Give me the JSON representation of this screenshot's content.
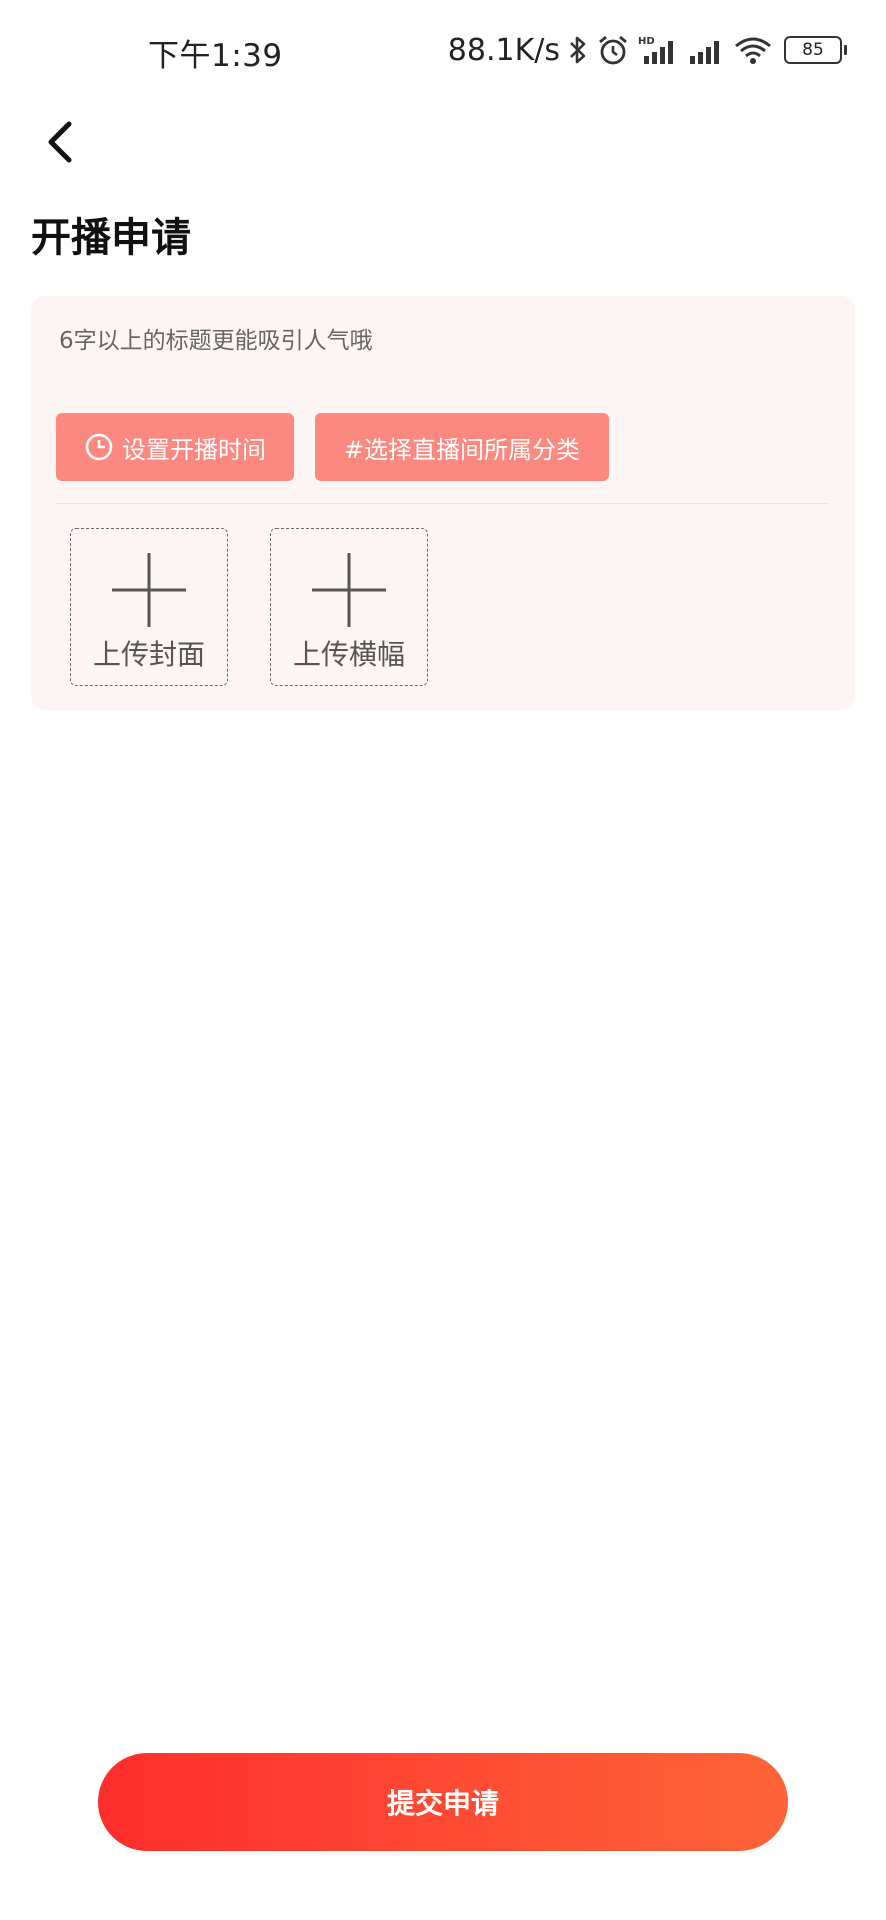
{
  "status_bar": {
    "time": "下午1:39",
    "net_speed": "88.1K/s",
    "battery": "85",
    "icons": [
      "bluetooth-icon",
      "alarm-icon",
      "hd-signal-icon",
      "signal-icon",
      "wifi-icon",
      "battery-icon"
    ]
  },
  "header": {
    "back_icon": "chevron-left-icon",
    "title": "开播申请"
  },
  "form": {
    "title_placeholder": "6字以上的标题更能吸引人气哦",
    "time_chip_label": "设置开播时间",
    "time_chip_icon": "clock-icon",
    "category_chip_label": "#选择直播间所属分类",
    "upload_cover_label": "上传封面",
    "upload_banner_label": "上传横幅"
  },
  "submit": {
    "label": "提交申请"
  },
  "colors": {
    "chip_bg": "#fc8880",
    "card_bg": "#fdf5f3",
    "gradient_start": "#fd2d2c",
    "gradient_end": "#fe6438"
  }
}
